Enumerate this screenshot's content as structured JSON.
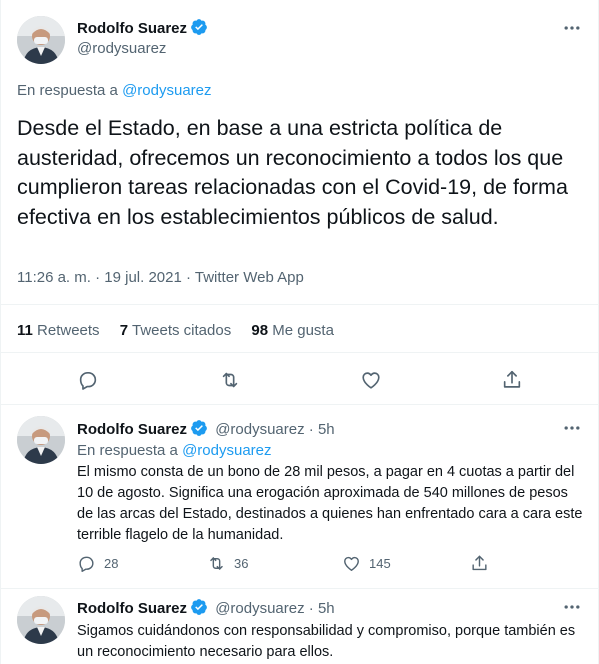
{
  "main_tweet": {
    "author_name": "Rodolfo Suarez",
    "author_handle": "@rodysuarez",
    "reply_prefix": "En respuesta a",
    "reply_to": "@rodysuarez",
    "text": "Desde el Estado, en base a una estricta política de austeridad, ofrecemos un reconocimiento a todos los que cumplieron tareas relacionadas con el Covid-19, de forma efectiva en los establecimientos públicos de salud.",
    "meta": "11:26 a. m. · 19 jul. 2021 · Twitter Web App",
    "stats": {
      "retweets_count": "11",
      "retweets_label": "Retweets",
      "quotes_count": "7",
      "quotes_label": "Tweets citados",
      "likes_count": "98",
      "likes_label": "Me gusta"
    }
  },
  "replies": [
    {
      "author_name": "Rodolfo Suarez",
      "author_handle": "@rodysuarez",
      "time": "· 5h",
      "reply_prefix": "En respuesta a",
      "reply_to": "@rodysuarez",
      "text": "El mismo consta de un bono de 28 mil pesos, a pagar en 4 cuotas a partir del 10 de agosto. Significa una erogación aproximada de 540 millones de pesos de las arcas del Estado, destinados a quienes han enfrentado cara a cara este terrible flagelo de la humanidad.",
      "reply_count": "28",
      "retweet_count": "36",
      "like_count": "145"
    },
    {
      "author_name": "Rodolfo Suarez",
      "author_handle": "@rodysuarez",
      "time": "· 5h",
      "text": "Sigamos cuidándonos con responsabilidad y compromiso, porque también es un reconocimiento necesario para ellos."
    }
  ],
  "colors": {
    "accent": "#1d9bf0",
    "text": "#0f1419",
    "muted": "#536471",
    "divider": "#eff3f4"
  },
  "icons": [
    "verified-badge-icon",
    "more-options-icon",
    "reply-icon",
    "retweet-icon",
    "like-icon",
    "share-icon"
  ]
}
